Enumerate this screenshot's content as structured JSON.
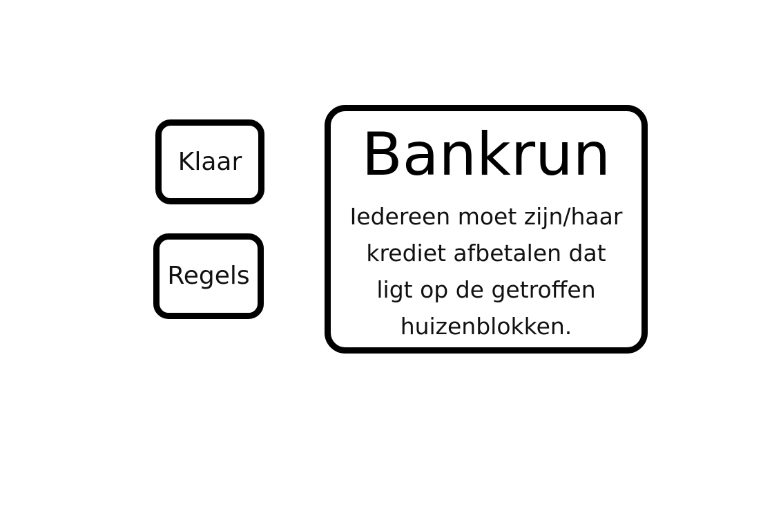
{
  "buttons": {
    "done_label": "Klaar",
    "rules_label": "Regels"
  },
  "card": {
    "title": "Bankrun",
    "description_lines": [
      "Iedereen moet zijn/haar",
      "krediet afbetalen dat",
      "ligt op de getroffen",
      "huizenblokken."
    ]
  },
  "colors": {
    "background": "#ffffff",
    "border": "#000000",
    "text": "#000000"
  }
}
